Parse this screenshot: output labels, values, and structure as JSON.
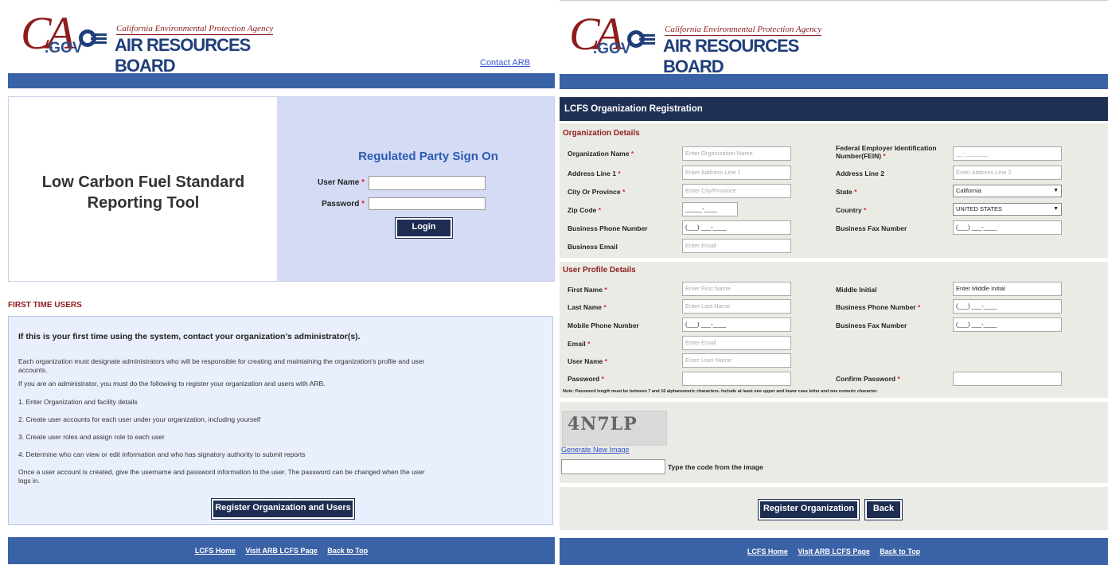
{
  "brand": {
    "ca": "CA",
    "gov": ".GOV",
    "agency": "California Environmental Protection Agency",
    "board": "AIR RESOURCES BOARD"
  },
  "signon": {
    "contact_link": "Contact ARB",
    "app_title_line1": "Low Carbon Fuel Standard",
    "app_title_line2": "Reporting Tool",
    "heading": "Regulated Party Sign On",
    "username_label": "User Name",
    "password_label": "Password",
    "required_mark": "*",
    "login_button": "Login"
  },
  "first_time": {
    "heading": "FIRST TIME USERS",
    "lead": "If this is your first time using the system, contact your organization's administrator(s).",
    "para1": "Each organization must designate administrators who will be responsible for creating and maintaining the organization's profile and user accounts.",
    "para2": "If you are an administrator, you must do the following to register your organization and users with ARB.",
    "steps": [
      "1. Enter Organization and facility details",
      "2. Create user accounts for each user under your organization, including yourself",
      "3. Create user roles and assign role to each user",
      "4. Determine who can view or edit information and who has signatory authority to submit reports"
    ],
    "para3": "Once a user account is created, give the username and password information to the user. The password can be changed when the user logs in.",
    "register_button": "Register Organization and Users"
  },
  "footer": {
    "links": [
      "LCFS Home",
      "Visit ARB LCFS Page",
      "Back to Top"
    ]
  },
  "registration": {
    "title": "LCFS Organization Registration",
    "org_section": "Organization Details",
    "org": {
      "name_label": "Organization Name",
      "name_placeholder": "Enter Organization Name",
      "fein_label": "Federal Employer Identification Number(FEIN)",
      "fein_mask": "__-_______",
      "addr1_label": "Address Line 1",
      "addr1_placeholder": "Enter Address Line 1",
      "addr2_label": "Address Line 2",
      "addr2_placeholder": "Enter Address Line 2",
      "city_label": "City Or Province",
      "city_placeholder": "Enter City/Province",
      "state_label": "State",
      "state_value": "California",
      "zip_label": "Zip Code",
      "zip_mask": "_____-____",
      "country_label": "Country",
      "country_value": "UNITED STATES",
      "phone_label": "Business Phone Number",
      "phone_mask": "(___) ___-____",
      "fax_label": "Business Fax Number",
      "fax_mask": "(___) ___-____",
      "email_label": "Business Email",
      "email_placeholder": "Enter Email"
    },
    "user_section": "User Profile Details",
    "user": {
      "first_label": "First Name",
      "first_placeholder": "Enter First Name",
      "middle_label": "Middle Initial",
      "middle_value": "Enter Middle Initial",
      "last_label": "Last Name",
      "last_placeholder": "Enter Last Name",
      "bphone_label": "Business Phone Number",
      "bphone_mask": "(___) ___-____",
      "mobile_label": "Mobile Phone Number",
      "mobile_mask": "(___) ___-____",
      "bfax_label": "Business Fax Number",
      "bfax_mask": "(___) ___-____",
      "email_label": "Email",
      "email_placeholder": "Enter Email",
      "username_label": "User Name",
      "username_placeholder": "Enter User Name",
      "password_label": "Password",
      "confirm_label": "Confirm Password",
      "note": "Note: Password length must be between 7 and 16 alphanumeric characters. Include at least one upper and lower case letter and one numeric character."
    },
    "captcha": {
      "code": "4N7LP",
      "generate_link": "Generate New Image",
      "instruction": "Type the code from the image"
    },
    "register_button": "Register Organization",
    "back_button": "Back"
  }
}
